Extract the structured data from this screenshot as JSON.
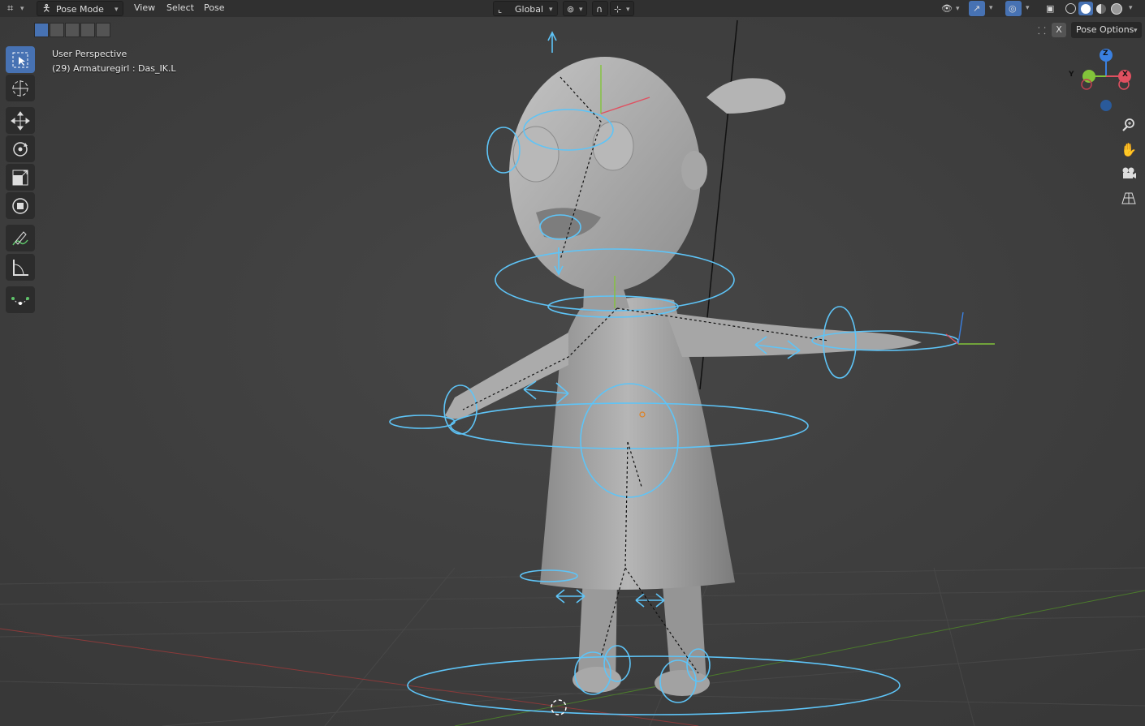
{
  "header": {
    "mode": "Pose Mode",
    "menus": [
      "View",
      "Select",
      "Pose"
    ],
    "orientation": "Global",
    "pose_options": "Pose Options",
    "x_toggle": "X"
  },
  "viewport": {
    "perspective": "User Perspective",
    "active_object": "(29) Armaturegirl : Das_IK.L"
  },
  "gizmo": {
    "x_label": "X",
    "y_label": "Y",
    "z_label": "Z"
  },
  "colors": {
    "accent": "#4772b3",
    "bone": "#5ec4f7",
    "axis_x": "#e05060",
    "axis_y": "#82c43a",
    "axis_z": "#3a80e0"
  },
  "icons": {
    "toolbar": [
      "select-box-icon",
      "cursor-icon",
      "move-icon",
      "rotate-icon",
      "scale-icon",
      "transform-icon",
      "annotate-icon",
      "measure-icon",
      "bone-tool-icon"
    ],
    "nav": [
      "zoom-icon",
      "hand-icon",
      "camera-icon",
      "grid-icon"
    ]
  }
}
